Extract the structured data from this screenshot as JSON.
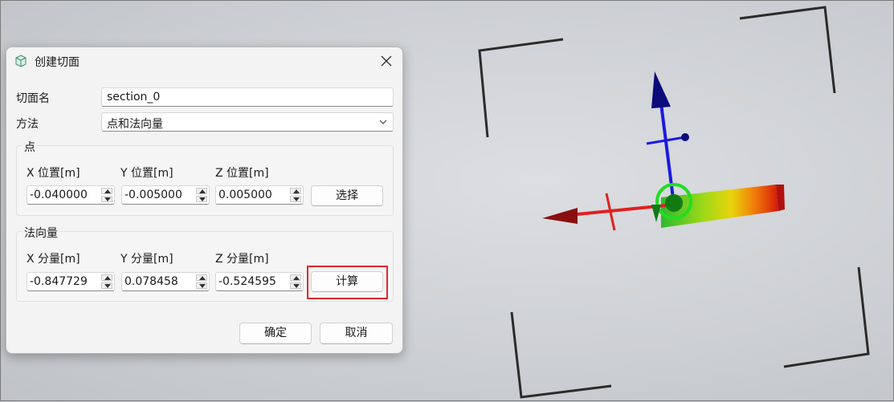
{
  "dialog": {
    "title": "创建切面",
    "section_name_label": "切面名",
    "section_name_value": "section_0",
    "method_label": "方法",
    "method_value": "点和法向量",
    "point_group": {
      "title": "点",
      "x_label": "X 位置[m]",
      "y_label": "Y 位置[m]",
      "z_label": "Z 位置[m]",
      "x_value": "-0.040000",
      "y_value": "-0.005000",
      "z_value": "0.005000",
      "select_button": "选择"
    },
    "normal_group": {
      "title": "法向量",
      "x_label": "X 分量[m]",
      "y_label": "Y 分量[m]",
      "z_label": "Z 分量[m]",
      "x_value": "-0.847729",
      "y_value": "0.078458",
      "z_value": "-0.524595",
      "compute_button": "计算"
    },
    "ok_button": "确定",
    "cancel_button": "取消"
  },
  "icons": {
    "title": "cube-icon",
    "close": "close-icon",
    "dropdown": "chevron-down-icon"
  },
  "colors": {
    "highlight": "#e0262c",
    "axis_x": "#e02020",
    "axis_y": "#1a1ae0",
    "gizmo_ring": "#22dd22"
  }
}
